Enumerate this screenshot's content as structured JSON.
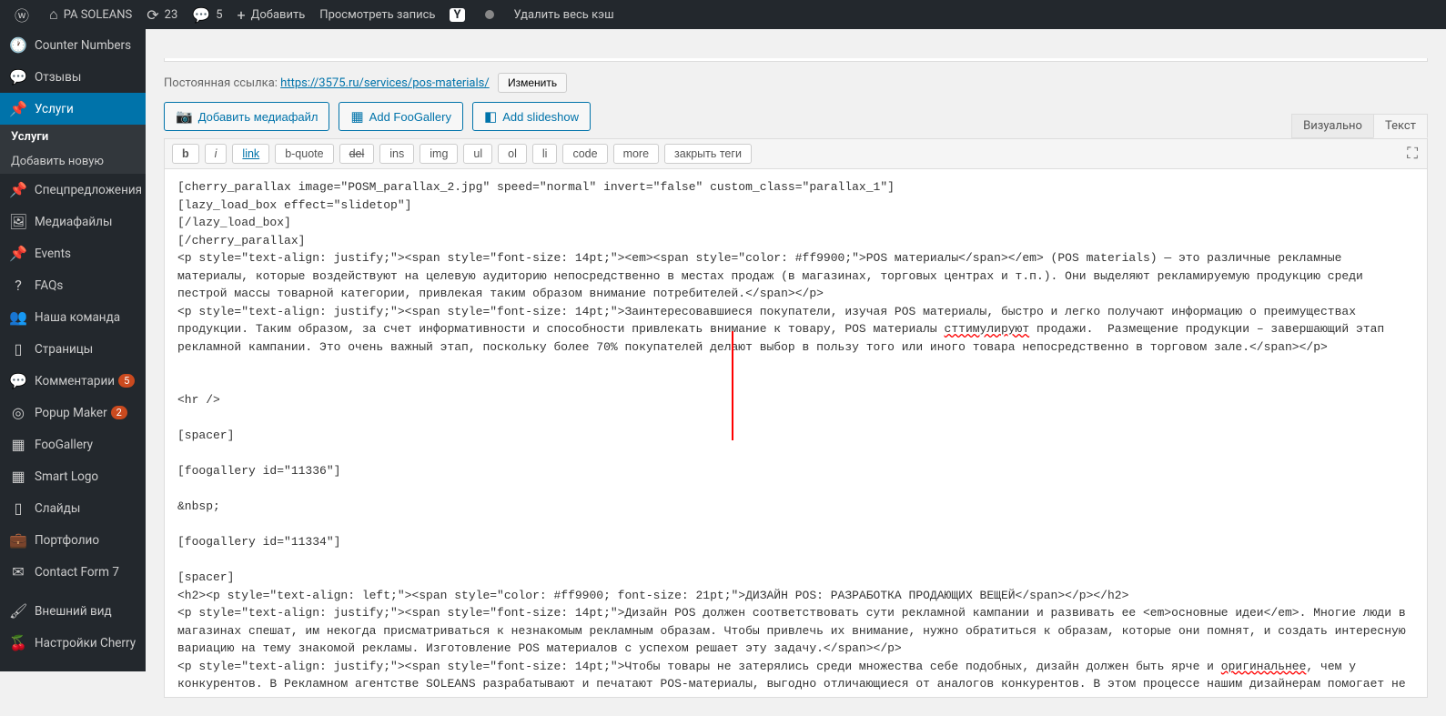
{
  "topbar": {
    "site_name": "PA SOLEANS",
    "updates": "23",
    "comments": "5",
    "add": "Добавить",
    "view_post": "Просмотреть запись",
    "clear_cache": "Удалить весь кэш"
  },
  "sidebar": {
    "counter": "Counter Numbers",
    "reviews": "Отзывы",
    "services": "Услуги",
    "services_sub_all": "Услуги",
    "services_sub_add": "Добавить новую",
    "specials": "Спецпредложения",
    "media": "Медиафайлы",
    "events": "Events",
    "faqs": "FAQs",
    "team": "Наша команда",
    "pages": "Страницы",
    "comments": "Комментарии",
    "comments_badge": "5",
    "popup": "Popup Maker",
    "popup_badge": "2",
    "foogallery": "FooGallery",
    "smartlogo": "Smart Logo",
    "slides": "Слайды",
    "portfolio": "Портфолио",
    "contact": "Contact Form 7",
    "appearance": "Внешний вид",
    "cherry": "Настройки Cherry"
  },
  "permalink": {
    "label": "Постоянная ссылка:",
    "url": "https://3575.ru/services/pos-materials/",
    "edit": "Изменить"
  },
  "media": {
    "add_media": "Добавить медиафайл",
    "add_foo": "Add FooGallery",
    "add_slide": "Add slideshow"
  },
  "tabs": {
    "visual": "Визуально",
    "text": "Текст"
  },
  "quicktags": {
    "b": "b",
    "i": "i",
    "link": "link",
    "bquote": "b-quote",
    "del": "del",
    "ins": "ins",
    "img": "img",
    "ul": "ul",
    "ol": "ol",
    "li": "li",
    "code": "code",
    "more": "more",
    "close": "закрыть теги"
  },
  "content": {
    "lines": [
      "[cherry_parallax image=\"POSM_parallax_2.jpg\" speed=\"normal\" invert=\"false\" custom_class=\"parallax_1\"]",
      "[lazy_load_box effect=\"slidetop\"]",
      "[/lazy_load_box]",
      "[/cherry_parallax]",
      "<p style=\"text-align: justify;\"><span style=\"font-size: 14pt;\"><em><span style=\"color: #ff9900;\">POS материалы</span></em> (POS materials) — это различные рекламные материалы, которые воздействуют на целевую аудиторию непосредственно в местах продаж (в магазинах, торговых центрах и т.п.). Они выделяют рекламируемую продукцию среди пестрой массы товарной категории, привлекая таким образом внимание потребителей.</span></p>",
      "<p style=\"text-align: justify;\"><span style=\"font-size: 14pt;\">Заинтересовавшиеся покупатели, изучая POS материалы, быстро и легко получают информацию о преимуществах продукции. Таким образом, за счет информативности и способности привлекать внимание к товару, POS материалы сттимулируют продажи.  Размещение продукции – завершающий этап рекламной кампании. Это очень важный этап, поскольку более 70% покупателей делают выбор в пользу того или иного товара непосредственно в торговом зале.</span></p>",
      "",
      "",
      "<hr />",
      "",
      "[spacer]",
      "",
      "[foogallery id=\"11336\"]",
      "",
      "&nbsp;",
      "",
      "[foogallery id=\"11334\"]",
      "",
      "[spacer]",
      "<h2><p style=\"text-align: left;\"><span style=\"color: #ff9900; font-size: 21pt;\">ДИЗАЙН POS: РАЗРАБОТКА ПРОДАЮЩИХ ВЕЩЕЙ</span></p></h2>",
      "<p style=\"text-align: justify;\"><span style=\"font-size: 14pt;\">Дизайн POS должен соответствовать сути рекламной кампании и развивать ее <em>основные идеи</em>. Многие люди в магазинах спешат, им некогда присматриваться к незнакомым рекламным образам. Чтобы привлечь их внимание, нужно обратиться к образам, которые они помнят, и создать интересную вариацию на тему знакомой рекламы. Изготовление POS материалов с успехом решает эту задачу.</span></p>",
      "<p style=\"text-align: justify;\"><span style=\"font-size: 14pt;\">Чтобы товары не затерялись среди множества себе подобных, дизайн должен быть ярче и оригинальнее, чем у конкурентов. В Рекламном агентстве SOLEANS разрабатывают и печатают POS-материалы, выгодно отличающиеся от аналогов конкурентов. В этом процессе нашим дизайнерам помогает не только их креативность, но и умение тонко"
    ]
  }
}
